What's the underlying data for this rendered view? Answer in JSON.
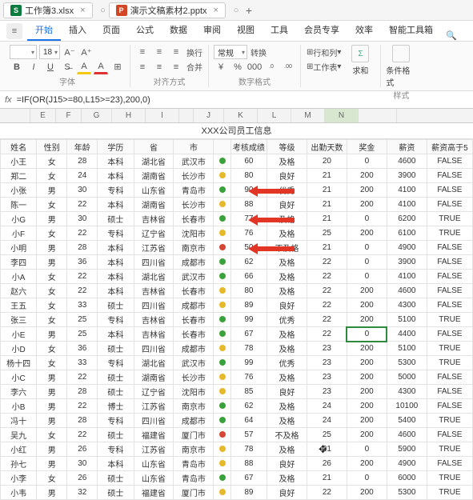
{
  "titlebar": {
    "tabs": [
      {
        "icon": "S",
        "label": "工作簿3.xlsx"
      },
      {
        "icon": "P",
        "label": "演示文稿素材2.pptx"
      }
    ]
  },
  "menu": {
    "left_icon": "≡",
    "items": [
      "开始",
      "插入",
      "页面",
      "公式",
      "数据",
      "审阅",
      "视图",
      "工具",
      "会员专享",
      "效率",
      "智能工具箱"
    ],
    "active_index": 0
  },
  "ribbon": {
    "font_size": "18",
    "a_minus": "A⁻",
    "a_plus": "A⁺",
    "bold": "B",
    "italic": "I",
    "underline": "U",
    "fill": "A",
    "fontcol": "A",
    "group_font": "字体",
    "wrap": "换行",
    "merge": "合并",
    "group_align": "对齐方式",
    "numfmt": "常规",
    "convert": "转换",
    "currency": "¥",
    "percent": "%",
    "comma": "000",
    "dec_inc": ".0→.00",
    "dec_dec": ".00→.0",
    "group_num": "数字格式",
    "rowcol": "行和列",
    "worksheet": "工作表",
    "sum": "求和",
    "group_edit": "",
    "condfmt": "条件格式",
    "group_style": "样式"
  },
  "formula": {
    "fx": "fx",
    "text": "=IF(OR(J15>=80,L15>=23),200,0)"
  },
  "cols": {
    "letters": [
      "",
      "E",
      "F",
      "G",
      "H",
      "I",
      "",
      "J",
      "K",
      "L",
      "M",
      "N",
      ""
    ],
    "widths": [
      38,
      32,
      32,
      38,
      42,
      42,
      18,
      38,
      42,
      42,
      42,
      42,
      48
    ],
    "selected": 11
  },
  "sheet_title": "XXX公司员工信息",
  "headers": [
    "姓名",
    "性别",
    "年龄",
    "学历",
    "省",
    "市",
    "",
    "考核成绩",
    "等级",
    "出勤天数",
    "奖金",
    "薪资",
    "薪资高于5"
  ],
  "rows": [
    {
      "n": "小王",
      "g": "女",
      "a": 28,
      "e": "本科",
      "p": "湖北省",
      "c": "武汉市",
      "d": "g",
      "s": 60,
      "lv": "及格",
      "at": 20,
      "bn": 0,
      "sal": 4600,
      "hi": "FALSE"
    },
    {
      "n": "郑二",
      "g": "女",
      "a": 24,
      "e": "本科",
      "p": "湖南省",
      "c": "长沙市",
      "d": "y",
      "s": 80,
      "lv": "良好",
      "at": 21,
      "bn": 200,
      "sal": 3900,
      "hi": "FALSE"
    },
    {
      "n": "小张",
      "g": "男",
      "a": 30,
      "e": "专科",
      "p": "山东省",
      "c": "青岛市",
      "d": "g",
      "s": 90,
      "lv": "优秀",
      "at": 21,
      "bn": 200,
      "sal": 4100,
      "hi": "FALSE",
      "arrow": true
    },
    {
      "n": "陈一",
      "g": "女",
      "a": 22,
      "e": "本科",
      "p": "湖南省",
      "c": "长沙市",
      "d": "y",
      "s": 88,
      "lv": "良好",
      "at": 21,
      "bn": 200,
      "sal": 4100,
      "hi": "FALSE"
    },
    {
      "n": "小G",
      "g": "男",
      "a": 30,
      "e": "硕士",
      "p": "吉林省",
      "c": "长春市",
      "d": "g",
      "s": 77,
      "lv": "及格",
      "at": 21,
      "bn": 0,
      "sal": 6200,
      "hi": "TRUE",
      "arrow": true
    },
    {
      "n": "小F",
      "g": "女",
      "a": 22,
      "e": "专科",
      "p": "辽宁省",
      "c": "沈阳市",
      "d": "y",
      "s": 76,
      "lv": "及格",
      "at": 25,
      "bn": 200,
      "sal": 6100,
      "hi": "TRUE"
    },
    {
      "n": "小明",
      "g": "男",
      "a": 28,
      "e": "本科",
      "p": "江苏省",
      "c": "南京市",
      "d": "r",
      "s": 50,
      "lv": "不及格",
      "at": 21,
      "bn": 0,
      "sal": 4900,
      "hi": "FALSE",
      "arrow": true
    },
    {
      "n": "李四",
      "g": "男",
      "a": 36,
      "e": "本科",
      "p": "四川省",
      "c": "成都市",
      "d": "g",
      "s": 62,
      "lv": "及格",
      "at": 22,
      "bn": 0,
      "sal": 3900,
      "hi": "FALSE"
    },
    {
      "n": "小A",
      "g": "女",
      "a": 22,
      "e": "本科",
      "p": "湖北省",
      "c": "武汉市",
      "d": "g",
      "s": 66,
      "lv": "及格",
      "at": 22,
      "bn": 0,
      "sal": 4100,
      "hi": "FALSE"
    },
    {
      "n": "赵六",
      "g": "女",
      "a": 22,
      "e": "本科",
      "p": "吉林省",
      "c": "长春市",
      "d": "y",
      "s": 80,
      "lv": "及格",
      "at": 22,
      "bn": 200,
      "sal": 4600,
      "hi": "FALSE"
    },
    {
      "n": "王五",
      "g": "女",
      "a": 33,
      "e": "硕士",
      "p": "四川省",
      "c": "成都市",
      "d": "y",
      "s": 89,
      "lv": "良好",
      "at": 22,
      "bn": 200,
      "sal": 4300,
      "hi": "FALSE"
    },
    {
      "n": "张三",
      "g": "女",
      "a": 25,
      "e": "专科",
      "p": "吉林省",
      "c": "长春市",
      "d": "g",
      "s": 99,
      "lv": "优秀",
      "at": 22,
      "bn": 200,
      "sal": 5100,
      "hi": "TRUE"
    },
    {
      "n": "小E",
      "g": "男",
      "a": 25,
      "e": "本科",
      "p": "吉林省",
      "c": "长春市",
      "d": "g",
      "s": 67,
      "lv": "及格",
      "at": 22,
      "bn": 0,
      "sal": 4400,
      "hi": "FALSE",
      "sel": true
    },
    {
      "n": "小D",
      "g": "女",
      "a": 36,
      "e": "硕士",
      "p": "四川省",
      "c": "成都市",
      "d": "y",
      "s": 78,
      "lv": "及格",
      "at": 23,
      "bn": 200,
      "sal": 5100,
      "hi": "TRUE"
    },
    {
      "n": "杨十四",
      "g": "女",
      "a": 33,
      "e": "专科",
      "p": "湖北省",
      "c": "武汉市",
      "d": "g",
      "s": 99,
      "lv": "优秀",
      "at": 23,
      "bn": 200,
      "sal": 5300,
      "hi": "TRUE"
    },
    {
      "n": "小C",
      "g": "男",
      "a": 22,
      "e": "硕士",
      "p": "湖南省",
      "c": "长沙市",
      "d": "y",
      "s": 76,
      "lv": "及格",
      "at": 23,
      "bn": 200,
      "sal": 5000,
      "hi": "FALSE"
    },
    {
      "n": "李六",
      "g": "男",
      "a": 28,
      "e": "硕士",
      "p": "辽宁省",
      "c": "沈阳市",
      "d": "y",
      "s": 85,
      "lv": "良好",
      "at": 23,
      "bn": 200,
      "sal": 4300,
      "hi": "FALSE"
    },
    {
      "n": "小B",
      "g": "男",
      "a": 22,
      "e": "博士",
      "p": "江苏省",
      "c": "南京市",
      "d": "g",
      "s": 62,
      "lv": "及格",
      "at": 24,
      "bn": 200,
      "sal": 10100,
      "hi": "FALSE"
    },
    {
      "n": "冯十",
      "g": "男",
      "a": 28,
      "e": "专科",
      "p": "四川省",
      "c": "成都市",
      "d": "g",
      "s": 64,
      "lv": "及格",
      "at": 24,
      "bn": 200,
      "sal": 5400,
      "hi": "TRUE"
    },
    {
      "n": "吴九",
      "g": "女",
      "a": 22,
      "e": "硕士",
      "p": "福建省",
      "c": "厦门市",
      "d": "r",
      "s": 57,
      "lv": "不及格",
      "at": 25,
      "bn": 200,
      "sal": 4600,
      "hi": "FALSE"
    },
    {
      "n": "小红",
      "g": "男",
      "a": 26,
      "e": "专科",
      "p": "江苏省",
      "c": "南京市",
      "d": "y",
      "s": 78,
      "lv": "及格",
      "at": 21,
      "bn": 0,
      "sal": 5900,
      "hi": "TRUE",
      "cursor": true
    },
    {
      "n": "孙七",
      "g": "男",
      "a": 30,
      "e": "本科",
      "p": "山东省",
      "c": "青岛市",
      "d": "y",
      "s": 88,
      "lv": "良好",
      "at": 26,
      "bn": 200,
      "sal": 4900,
      "hi": "FALSE"
    },
    {
      "n": "小李",
      "g": "女",
      "a": 26,
      "e": "硕士",
      "p": "山东省",
      "c": "青岛市",
      "d": "g",
      "s": 67,
      "lv": "及格",
      "at": 21,
      "bn": 0,
      "sal": 6000,
      "hi": "TRUE"
    },
    {
      "n": "小韦",
      "g": "男",
      "a": 32,
      "e": "硕士",
      "p": "福建省",
      "c": "厦门市",
      "d": "y",
      "s": 89,
      "lv": "良好",
      "at": 22,
      "bn": 200,
      "sal": 5300,
      "hi": "TRUE"
    }
  ]
}
